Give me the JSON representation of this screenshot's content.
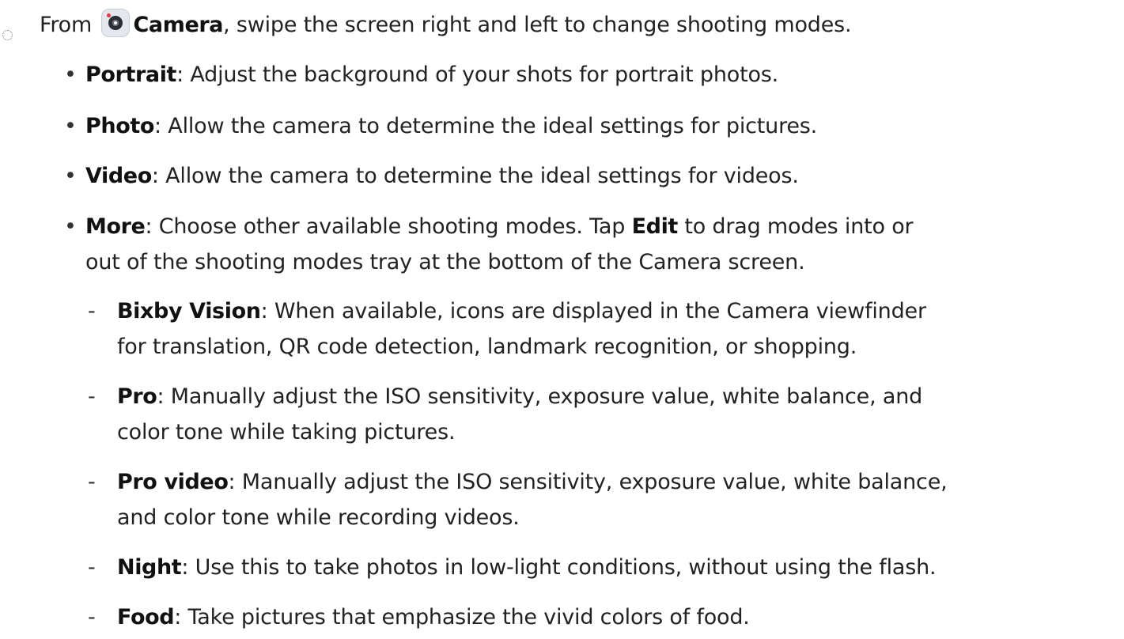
{
  "step": {
    "prefix": "From",
    "app_icon": "camera-app-icon",
    "app_name": "Camera",
    "text": ", swipe the screen right and left to change shooting modes."
  },
  "modes": [
    {
      "name": "Portrait",
      "desc": ": Adjust the background of your shots for portrait photos."
    },
    {
      "name": "Photo",
      "desc": ": Allow the camera to determine the ideal settings for pictures."
    },
    {
      "name": "Video",
      "desc": ": Allow the camera to determine the ideal settings for videos."
    },
    {
      "name": "More",
      "desc_line1_a": ": Choose other available shooting modes. Tap ",
      "edit": "Edit",
      "desc_line1_b": " to drag modes into or",
      "desc_line2": "out of the shooting modes tray at the bottom of the Camera screen."
    }
  ],
  "more_modes": [
    {
      "name": "Bixby Vision",
      "line1": ": When available, icons are displayed in the Camera viewfinder",
      "line2": "for translation, QR code detection, landmark recognition, or shopping."
    },
    {
      "name": "Pro",
      "line1": ": Manually adjust the ISO sensitivity, exposure value, white balance, and",
      "line2": "color tone while taking pictures."
    },
    {
      "name": "Pro video",
      "line1": ": Manually adjust the ISO sensitivity, exposure value, white balance,",
      "line2": "and color tone while recording videos."
    },
    {
      "name": "Night",
      "line1": ": Use this to take photos in low-light conditions, without using the flash."
    },
    {
      "name": "Food",
      "line1": ": Take pictures that emphasize the vivid colors of food."
    }
  ],
  "markers": {
    "bullet": "•",
    "dash": "-"
  }
}
